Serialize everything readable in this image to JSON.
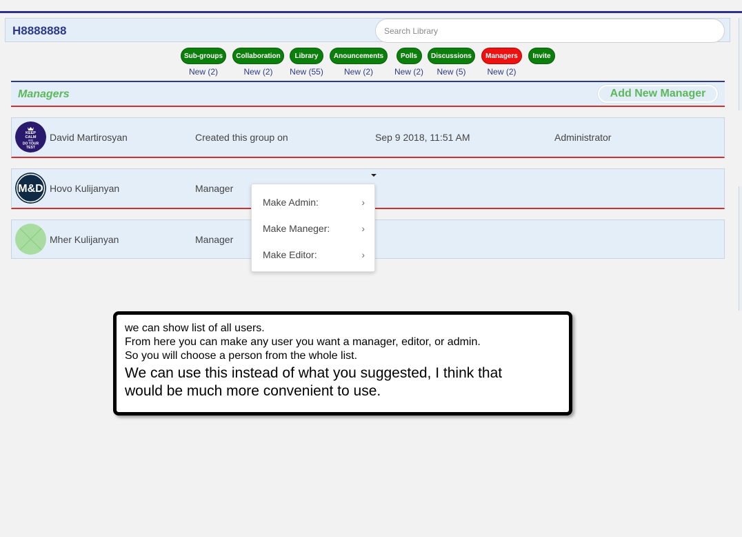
{
  "header": {
    "group_name": "H8888888",
    "search_placeholder": "Search Library"
  },
  "nav": [
    {
      "label": "Sub-groups",
      "count": "New (2)",
      "color": "#0b7e0b"
    },
    {
      "label": "Collaboration",
      "count": "New (2)",
      "color": "#0b7e0b"
    },
    {
      "label": "Library",
      "count": "New (55)",
      "color": "#0b7e0b"
    },
    {
      "label": "Anouncements",
      "count": "New (2)",
      "color": "#0b7e0b"
    },
    {
      "label": "Polls",
      "count": "New (2)",
      "color": "#0b7e0b"
    },
    {
      "label": "Discussions",
      "count": "New (5)",
      "color": "#0b7e0b"
    },
    {
      "label": "Managers",
      "count": "New (2)",
      "color": "#ee1111",
      "active": true
    },
    {
      "label": "Invite",
      "count": "",
      "color": "#0b7e0b"
    }
  ],
  "section": {
    "title": "Managers",
    "add_button": "Add New Manager"
  },
  "managers": [
    {
      "name": "David Martirosyan",
      "role_text": "Created this group on",
      "date": "Sep 9 2018, 11:51 AM",
      "title": "Administrator",
      "avatar_icon": "keep-calm-avatar-icon"
    },
    {
      "name": "Hovo Kulijanyan",
      "role_text": "Manager",
      "date": "",
      "title": "",
      "avatar_icon": "md-logo-avatar-icon"
    },
    {
      "name": "Mher Kulijanyan",
      "role_text": "Manager",
      "date": "",
      "title": "",
      "avatar_icon": "placeholder-avatar-icon"
    }
  ],
  "avatar_texts": {
    "keep_calm": [
      "KEEP",
      "CALM",
      "AND",
      "DO YOUR",
      "TEST"
    ],
    "md": "M&D"
  },
  "dropdown_menu": [
    {
      "label": "Make Admin:"
    },
    {
      "label": "Make Maneger:"
    },
    {
      "label": "Make Editor:"
    }
  ],
  "note": {
    "lines_small": [
      "we can show list of all users.",
      "From here you can make any user you want a manager, editor, or admin.",
      "So you will choose a person from the whole list."
    ],
    "lines_big": [
      "We can use this instead of what you suggested, I think that",
      "would be much more convenient to use."
    ]
  },
  "colors": {
    "accent_blue": "#2e3a87",
    "green_pill": "#0b7e0b",
    "active_red": "#ee1111",
    "section_green": "#5cb85c",
    "row_bg": "#e4eef8",
    "divider_red": "#d03030"
  }
}
